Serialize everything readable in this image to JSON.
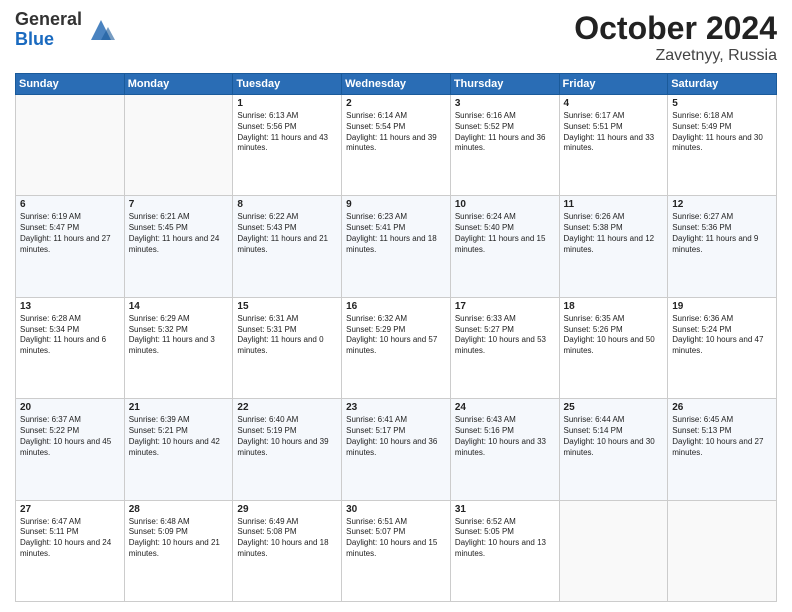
{
  "header": {
    "logo_general": "General",
    "logo_blue": "Blue",
    "month": "October 2024",
    "location": "Zavetnyy, Russia"
  },
  "weekdays": [
    "Sunday",
    "Monday",
    "Tuesday",
    "Wednesday",
    "Thursday",
    "Friday",
    "Saturday"
  ],
  "weeks": [
    [
      {
        "day": "",
        "info": ""
      },
      {
        "day": "",
        "info": ""
      },
      {
        "day": "1",
        "info": "Sunrise: 6:13 AM\nSunset: 5:56 PM\nDaylight: 11 hours and 43 minutes."
      },
      {
        "day": "2",
        "info": "Sunrise: 6:14 AM\nSunset: 5:54 PM\nDaylight: 11 hours and 39 minutes."
      },
      {
        "day": "3",
        "info": "Sunrise: 6:16 AM\nSunset: 5:52 PM\nDaylight: 11 hours and 36 minutes."
      },
      {
        "day": "4",
        "info": "Sunrise: 6:17 AM\nSunset: 5:51 PM\nDaylight: 11 hours and 33 minutes."
      },
      {
        "day": "5",
        "info": "Sunrise: 6:18 AM\nSunset: 5:49 PM\nDaylight: 11 hours and 30 minutes."
      }
    ],
    [
      {
        "day": "6",
        "info": "Sunrise: 6:19 AM\nSunset: 5:47 PM\nDaylight: 11 hours and 27 minutes."
      },
      {
        "day": "7",
        "info": "Sunrise: 6:21 AM\nSunset: 5:45 PM\nDaylight: 11 hours and 24 minutes."
      },
      {
        "day": "8",
        "info": "Sunrise: 6:22 AM\nSunset: 5:43 PM\nDaylight: 11 hours and 21 minutes."
      },
      {
        "day": "9",
        "info": "Sunrise: 6:23 AM\nSunset: 5:41 PM\nDaylight: 11 hours and 18 minutes."
      },
      {
        "day": "10",
        "info": "Sunrise: 6:24 AM\nSunset: 5:40 PM\nDaylight: 11 hours and 15 minutes."
      },
      {
        "day": "11",
        "info": "Sunrise: 6:26 AM\nSunset: 5:38 PM\nDaylight: 11 hours and 12 minutes."
      },
      {
        "day": "12",
        "info": "Sunrise: 6:27 AM\nSunset: 5:36 PM\nDaylight: 11 hours and 9 minutes."
      }
    ],
    [
      {
        "day": "13",
        "info": "Sunrise: 6:28 AM\nSunset: 5:34 PM\nDaylight: 11 hours and 6 minutes."
      },
      {
        "day": "14",
        "info": "Sunrise: 6:29 AM\nSunset: 5:32 PM\nDaylight: 11 hours and 3 minutes."
      },
      {
        "day": "15",
        "info": "Sunrise: 6:31 AM\nSunset: 5:31 PM\nDaylight: 11 hours and 0 minutes."
      },
      {
        "day": "16",
        "info": "Sunrise: 6:32 AM\nSunset: 5:29 PM\nDaylight: 10 hours and 57 minutes."
      },
      {
        "day": "17",
        "info": "Sunrise: 6:33 AM\nSunset: 5:27 PM\nDaylight: 10 hours and 53 minutes."
      },
      {
        "day": "18",
        "info": "Sunrise: 6:35 AM\nSunset: 5:26 PM\nDaylight: 10 hours and 50 minutes."
      },
      {
        "day": "19",
        "info": "Sunrise: 6:36 AM\nSunset: 5:24 PM\nDaylight: 10 hours and 47 minutes."
      }
    ],
    [
      {
        "day": "20",
        "info": "Sunrise: 6:37 AM\nSunset: 5:22 PM\nDaylight: 10 hours and 45 minutes."
      },
      {
        "day": "21",
        "info": "Sunrise: 6:39 AM\nSunset: 5:21 PM\nDaylight: 10 hours and 42 minutes."
      },
      {
        "day": "22",
        "info": "Sunrise: 6:40 AM\nSunset: 5:19 PM\nDaylight: 10 hours and 39 minutes."
      },
      {
        "day": "23",
        "info": "Sunrise: 6:41 AM\nSunset: 5:17 PM\nDaylight: 10 hours and 36 minutes."
      },
      {
        "day": "24",
        "info": "Sunrise: 6:43 AM\nSunset: 5:16 PM\nDaylight: 10 hours and 33 minutes."
      },
      {
        "day": "25",
        "info": "Sunrise: 6:44 AM\nSunset: 5:14 PM\nDaylight: 10 hours and 30 minutes."
      },
      {
        "day": "26",
        "info": "Sunrise: 6:45 AM\nSunset: 5:13 PM\nDaylight: 10 hours and 27 minutes."
      }
    ],
    [
      {
        "day": "27",
        "info": "Sunrise: 6:47 AM\nSunset: 5:11 PM\nDaylight: 10 hours and 24 minutes."
      },
      {
        "day": "28",
        "info": "Sunrise: 6:48 AM\nSunset: 5:09 PM\nDaylight: 10 hours and 21 minutes."
      },
      {
        "day": "29",
        "info": "Sunrise: 6:49 AM\nSunset: 5:08 PM\nDaylight: 10 hours and 18 minutes."
      },
      {
        "day": "30",
        "info": "Sunrise: 6:51 AM\nSunset: 5:07 PM\nDaylight: 10 hours and 15 minutes."
      },
      {
        "day": "31",
        "info": "Sunrise: 6:52 AM\nSunset: 5:05 PM\nDaylight: 10 hours and 13 minutes."
      },
      {
        "day": "",
        "info": ""
      },
      {
        "day": "",
        "info": ""
      }
    ]
  ]
}
